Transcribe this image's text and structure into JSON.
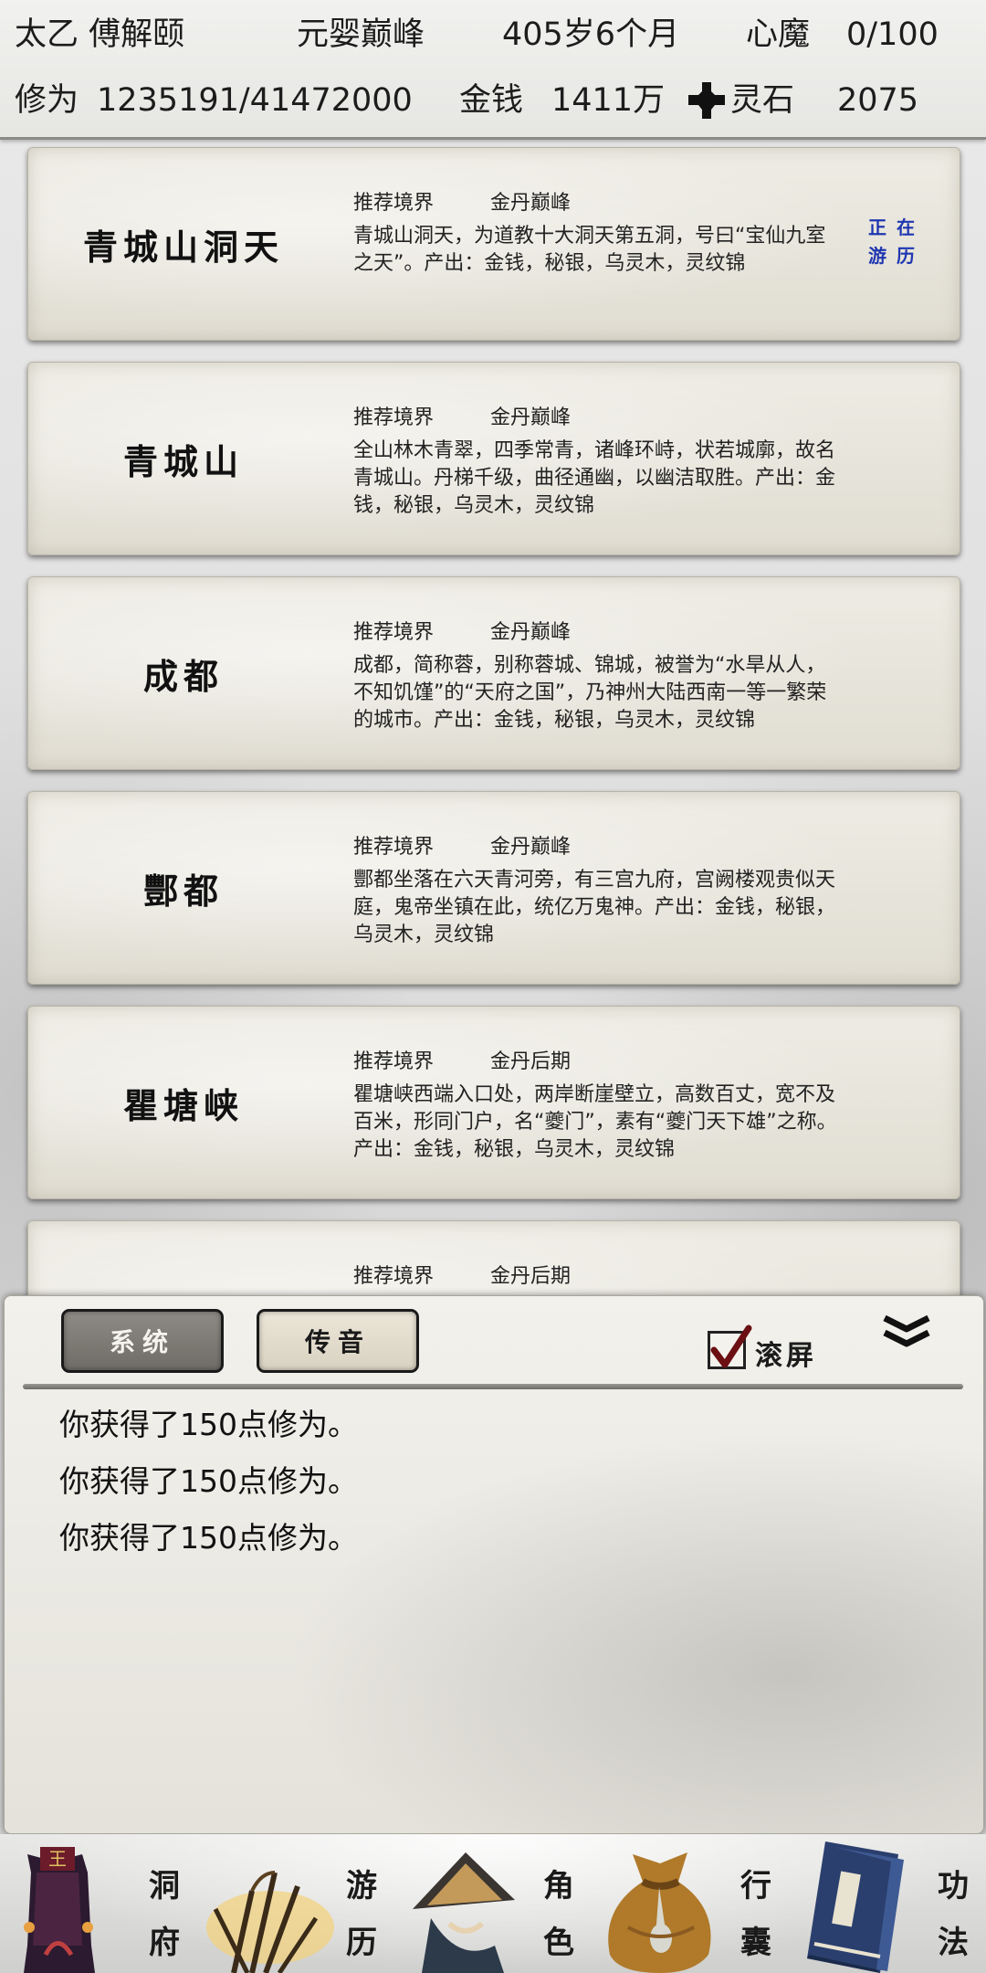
{
  "header": {
    "name": "太乙 傅解颐",
    "realm": "元婴巅峰",
    "age": "405岁6个月",
    "demon_label": "心魔",
    "demon_value": "0/100",
    "cultivation_label": "修为",
    "cultivation_value": "1235191/41472000",
    "money_label": "金钱",
    "money_value": "1411万",
    "stone_label": "灵石",
    "stone_value": "2075"
  },
  "locations": [
    {
      "name": "青城山洞天",
      "realm_label": "推荐境界",
      "realm": "金丹巅峰",
      "description": "青城山洞天，为道教十大洞天第五洞，号曰“宝仙九室之天”。产出：金钱，秘银，乌灵木，灵纹锦",
      "status": "正在游历"
    },
    {
      "name": "青城山",
      "realm_label": "推荐境界",
      "realm": "金丹巅峰",
      "description": "全山林木青翠，四季常青，诸峰环峙，状若城廓，故名青城山。丹梯千级，曲径通幽，以幽洁取胜。产出：金钱，秘银，乌灵木，灵纹锦"
    },
    {
      "name": "成都",
      "realm_label": "推荐境界",
      "realm": "金丹巅峰",
      "description": "成都，简称蓉，别称蓉城、锦城，被誉为“水旱从人，不知饥馑”的“天府之国”，乃神州大陆西南一等一繁荣的城市。产出：金钱，秘银，乌灵木，灵纹锦"
    },
    {
      "name": "酆都",
      "realm_label": "推荐境界",
      "realm": "金丹巅峰",
      "description": "酆都坐落在六天青河旁，有三宫九府，宫阙楼观贵似天庭，鬼帝坐镇在此，统亿万鬼神。产出：金钱，秘银，乌灵木，灵纹锦"
    },
    {
      "name": "瞿塘峡",
      "realm_label": "推荐境界",
      "realm": "金丹后期",
      "description": "瞿塘峡西端入口处，两岸断崖壁立，高数百丈，宽不及百米，形同门户，名“夔门”，素有“夔门天下雄”之称。产出：金钱，秘银，乌灵木，灵纹锦"
    },
    {
      "name": "",
      "realm_label": "推荐境界",
      "realm": "金丹后期",
      "description": ""
    }
  ],
  "messages": {
    "tab_system": "系统",
    "tab_voice": "传音",
    "scroll_label": "滚屏",
    "scroll_checked": true,
    "lines": [
      "你获得了150点修为。",
      "你获得了150点修为。",
      "你获得了150点修为。"
    ]
  },
  "nav": [
    {
      "label": "洞府",
      "icon": "cave-dwelling-icon"
    },
    {
      "label": "游历",
      "icon": "travel-grass-icon"
    },
    {
      "label": "角色",
      "icon": "character-hat-icon"
    },
    {
      "label": "行囊",
      "icon": "bag-icon"
    },
    {
      "label": "功法",
      "icon": "book-icon"
    }
  ],
  "colors": {
    "status_text": "#1f36b0",
    "system_tab_bg": "#7d7a74",
    "voice_tab_bg": "#e2dccd"
  }
}
